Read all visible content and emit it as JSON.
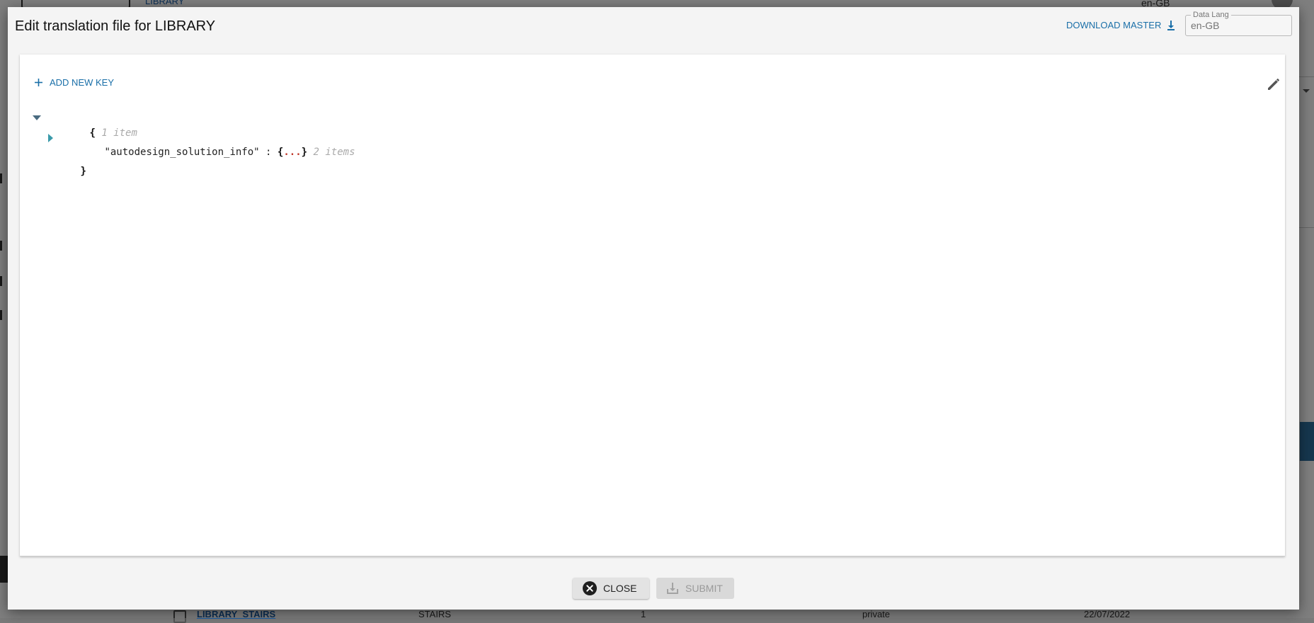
{
  "background": {
    "breadcrumb": "LIBRARY",
    "language": "en-GB",
    "table_row": {
      "name": "LIBRARY_STAIRS",
      "category": "STAIRS",
      "count": "1",
      "visibility": "private",
      "date": "22/07/2022"
    }
  },
  "dialog": {
    "title": "Edit translation file for LIBRARY",
    "download_master_label": "DOWNLOAD MASTER",
    "data_lang": {
      "label": "Data Lang",
      "placeholder": "en-GB"
    },
    "add_new_key_label": "ADD NEW KEY",
    "json_tree": {
      "root_open": "{",
      "root_count": "1 item",
      "child_key": "\"autodesign_solution_info\"",
      "child_separator": ":",
      "child_open": "{",
      "child_ellipsis": "...",
      "child_close": "}",
      "child_count": "2 items",
      "root_close": "}"
    },
    "close_label": "CLOSE",
    "submit_label": "SUBMIT"
  },
  "colors": {
    "accent": "#1a6fa8",
    "ellipsis": "#c0392b",
    "dialog_background": "#f4f4f4"
  }
}
